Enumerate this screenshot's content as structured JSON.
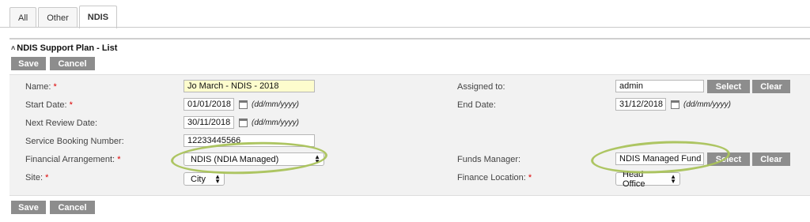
{
  "tabs": [
    {
      "label": "All",
      "active": false
    },
    {
      "label": "Other",
      "active": false
    },
    {
      "label": "NDIS",
      "active": true
    }
  ],
  "section": {
    "title": "NDIS Support Plan  - List",
    "collapse_icon": "double-chevron-up-icon"
  },
  "buttons": {
    "save": "Save",
    "cancel": "Cancel",
    "select": "Select",
    "clear": "Clear"
  },
  "form": {
    "name": {
      "label": "Name:",
      "required_mark": "*",
      "value": "Jo March - NDIS - 2018"
    },
    "start_date": {
      "label": "Start Date:",
      "required_mark": "*",
      "value": "01/01/2018",
      "format": "(dd/mm/yyyy)"
    },
    "next_review_date": {
      "label": "Next Review Date:",
      "value": "30/11/2018",
      "format": "(dd/mm/yyyy)"
    },
    "service_booking_number": {
      "label": "Service Booking Number:",
      "value": "12233445566"
    },
    "financial_arrangement": {
      "label": "Financial Arrangement:",
      "required_mark": "*",
      "value": "NDIS (NDIA Managed)"
    },
    "site": {
      "label": "Site:",
      "required_mark": "*",
      "value": "City"
    },
    "assigned_to": {
      "label": "Assigned to:",
      "value": "admin"
    },
    "end_date": {
      "label": "End Date:",
      "value": "31/12/2018",
      "format": "(dd/mm/yyyy)"
    },
    "funds_manager": {
      "label": "Funds Manager:",
      "value": "NDIS Managed Fund"
    },
    "finance_location": {
      "label": "Finance Location:",
      "required_mark": "*",
      "value": "Head Office"
    }
  },
  "colors": {
    "button_bg": "#8d8d8d",
    "required": "#dd0000",
    "highlight_ellipse": "#a9c25a",
    "name_field_bg": "#fdfccd"
  }
}
